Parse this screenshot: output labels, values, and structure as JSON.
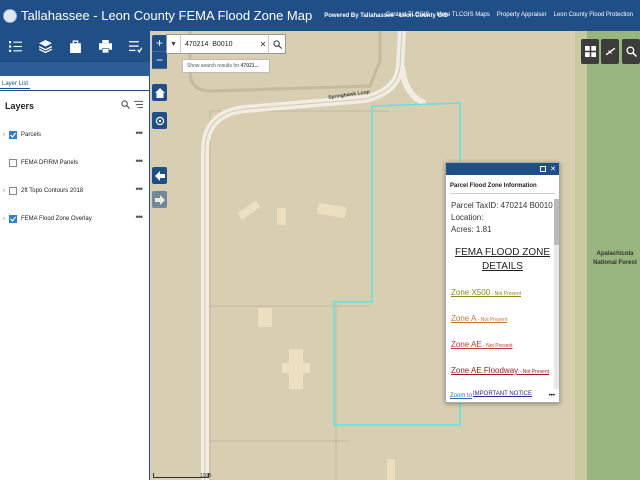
{
  "header": {
    "title": "Tallahassee - Leon County FEMA Flood Zone Map",
    "subtitle": "Powered By Tallahassee - Leon County GIS",
    "links": [
      "Contact TLCGIS",
      "More TLCGIS Maps",
      "Property Appraiser",
      "Leon County Flood Protection"
    ]
  },
  "panel": {
    "tab_label": "Layer List",
    "heading": "Layers",
    "layers": [
      {
        "label": "Parcels",
        "checked": true
      },
      {
        "label": "FEMA DFIRM Panels",
        "checked": false
      },
      {
        "label": "2ft Topo Contours 2018",
        "checked": false
      },
      {
        "label": "FEMA Flood Zone Overlay",
        "checked": true
      }
    ],
    "more": "•••"
  },
  "search": {
    "value": "470214  B0010",
    "suggestion_prefix": "Show search results for ",
    "suggestion_term": "47021..."
  },
  "map": {
    "road_label": "Springhawk Loop",
    "forest_label": "Apalachicola National Forest",
    "scale_label": "100ft",
    "colors": {
      "parcel_outline": "#5fe3e0",
      "forest": "#97b57d",
      "terrain": "#d8cfb2"
    }
  },
  "popup": {
    "title": "Parcel Flood Zone Information",
    "taxid_line": "Parcel TaxID: 470214 B0010",
    "location_line": "Location:",
    "acres_line": "Acres: 1.81",
    "fz_title_1": "FEMA FLOOD ZONE",
    "fz_title_2": "DETAILS",
    "zones": [
      {
        "name": "Zone X500",
        "status": " - Not Present",
        "color": "#8a8a1a"
      },
      {
        "name": "Zone A",
        "status": " - Not Present",
        "color": "#c8742e"
      },
      {
        "name": "Zone AE",
        "status": " - Not Present",
        "color": "#c23a3a"
      },
      {
        "name": "Zone AE Floodway",
        "status": " - Not Present",
        "color": "#9b1b1b"
      }
    ],
    "notice": "IMPORTANT NOTICE",
    "zoom_to": "Zoom to",
    "more": "•••"
  }
}
